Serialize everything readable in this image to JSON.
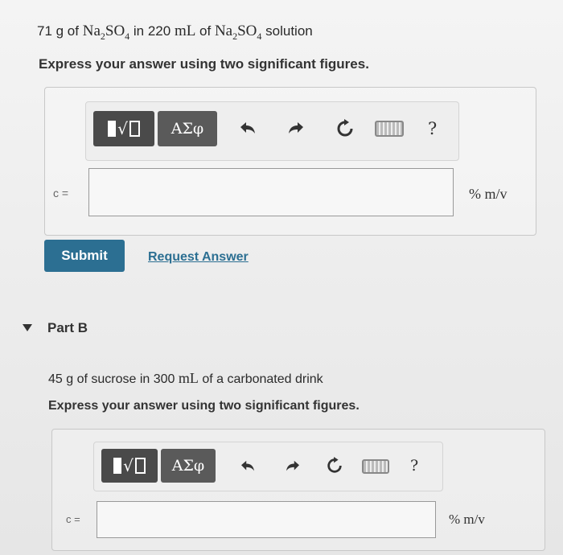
{
  "partA": {
    "question": {
      "mass": "71 g of ",
      "formula_main": "Na",
      "sub1": "2",
      "formula_mid": "SO",
      "sub2": "4",
      "mid": " in 220 ",
      "unit_ml": "mL",
      "of": " of ",
      "formula2_main": "Na",
      "sub3": "2",
      "formula2_mid": "SO",
      "sub4": "4",
      "tail": " solution"
    },
    "instruction": "Express your answer using two significant figures.",
    "toolbar": {
      "greek_label": "ΑΣφ",
      "radical_glyph": "√",
      "help_label": "?"
    },
    "answer": {
      "variable_label": "c =",
      "value": "",
      "unit": "% m/v"
    },
    "submit_label": "Submit",
    "request_label": "Request Answer"
  },
  "partB": {
    "title": "Part B",
    "question": {
      "mass": "45 g of sucrose in 300 ",
      "unit_ml": "mL",
      "tail": " of a carbonated drink"
    },
    "instruction": "Express your answer using two significant figures.",
    "toolbar": {
      "greek_label": "ΑΣφ",
      "radical_glyph": "√",
      "help_label": "?"
    },
    "answer": {
      "variable_label": "c =",
      "value": "",
      "unit": "% m/v"
    }
  },
  "icons": {
    "undo": "undo-icon",
    "redo": "redo-icon",
    "reset": "reset-icon",
    "keyboard": "keyboard-icon",
    "expand": "triangle-down-icon"
  }
}
